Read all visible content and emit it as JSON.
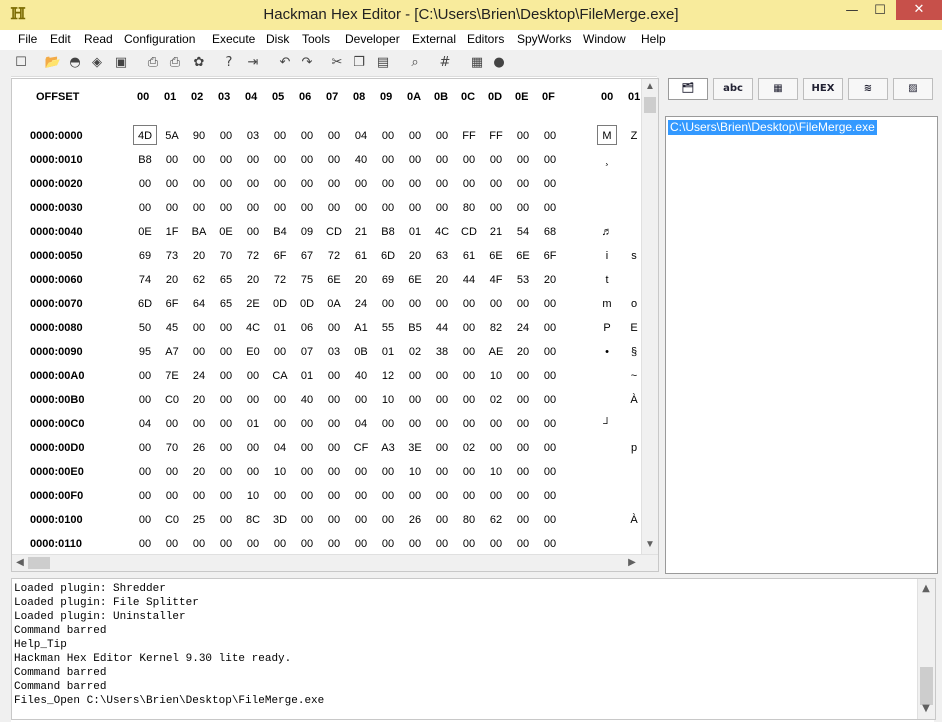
{
  "window": {
    "title": "Hackman Hex Editor - [C:\\Users\\Brien\\Desktop\\FileMerge.exe]",
    "app_icon_glyph": "ℍ",
    "minimize": "—",
    "maximize": "☐",
    "close": "✕",
    "title_bar_color": "#f8eb9c"
  },
  "menu": [
    "File",
    "Edit",
    "Read",
    "Configuration",
    "Execute",
    "Disk",
    "Tools",
    "Developer",
    "External",
    "Editors",
    "SpyWorks",
    "Window",
    "Help"
  ],
  "toolbar_icons": [
    {
      "name": "new-file-icon",
      "glyph": "☐"
    },
    {
      "name": "open-folder-icon",
      "glyph": "📂"
    },
    {
      "name": "open-disk-icon",
      "glyph": "◓"
    },
    {
      "name": "open-drive-icon",
      "glyph": "◈"
    },
    {
      "name": "save-icon",
      "glyph": "▣"
    },
    {
      "name": "print-icon",
      "glyph": "⎙"
    },
    {
      "name": "print-preview-icon",
      "glyph": "⎙"
    },
    {
      "name": "properties-icon",
      "glyph": "✿"
    },
    {
      "name": "help-icon",
      "glyph": "?"
    },
    {
      "name": "exit-icon",
      "glyph": "⇥"
    },
    {
      "name": "undo-icon",
      "glyph": "↶"
    },
    {
      "name": "redo-icon",
      "glyph": "↷"
    },
    {
      "name": "cut-icon",
      "glyph": "✂"
    },
    {
      "name": "copy-icon",
      "glyph": "❐"
    },
    {
      "name": "paste-icon",
      "glyph": "▤"
    },
    {
      "name": "find-icon",
      "glyph": "⌕"
    },
    {
      "name": "goto-icon",
      "glyph": "#"
    },
    {
      "name": "calculator-icon",
      "glyph": "▦"
    },
    {
      "name": "internet-icon",
      "glyph": "●"
    }
  ],
  "hex": {
    "offset_header": "OFFSET",
    "columns": [
      "00",
      "01",
      "02",
      "03",
      "04",
      "05",
      "06",
      "07",
      "08",
      "09",
      "0A",
      "0B",
      "0C",
      "0D",
      "0E",
      "0F"
    ],
    "char_columns": [
      "00",
      "01"
    ],
    "rows": [
      {
        "offset": "0000:0000",
        "bytes": [
          "4D",
          "5A",
          "90",
          "00",
          "03",
          "00",
          "00",
          "00",
          "04",
          "00",
          "00",
          "00",
          "FF",
          "FF",
          "00",
          "00"
        ],
        "chars": [
          "M",
          "Z"
        ]
      },
      {
        "offset": "0000:0010",
        "bytes": [
          "B8",
          "00",
          "00",
          "00",
          "00",
          "00",
          "00",
          "00",
          "40",
          "00",
          "00",
          "00",
          "00",
          "00",
          "00",
          "00"
        ],
        "chars": [
          "¸",
          ""
        ]
      },
      {
        "offset": "0000:0020",
        "bytes": [
          "00",
          "00",
          "00",
          "00",
          "00",
          "00",
          "00",
          "00",
          "00",
          "00",
          "00",
          "00",
          "00",
          "00",
          "00",
          "00"
        ],
        "chars": [
          "",
          ""
        ]
      },
      {
        "offset": "0000:0030",
        "bytes": [
          "00",
          "00",
          "00",
          "00",
          "00",
          "00",
          "00",
          "00",
          "00",
          "00",
          "00",
          "00",
          "80",
          "00",
          "00",
          "00"
        ],
        "chars": [
          "",
          ""
        ]
      },
      {
        "offset": "0000:0040",
        "bytes": [
          "0E",
          "1F",
          "BA",
          "0E",
          "00",
          "B4",
          "09",
          "CD",
          "21",
          "B8",
          "01",
          "4C",
          "CD",
          "21",
          "54",
          "68"
        ],
        "chars": [
          "♬",
          ""
        ]
      },
      {
        "offset": "0000:0050",
        "bytes": [
          "69",
          "73",
          "20",
          "70",
          "72",
          "6F",
          "67",
          "72",
          "61",
          "6D",
          "20",
          "63",
          "61",
          "6E",
          "6E",
          "6F"
        ],
        "chars": [
          "i",
          "s"
        ]
      },
      {
        "offset": "0000:0060",
        "bytes": [
          "74",
          "20",
          "62",
          "65",
          "20",
          "72",
          "75",
          "6E",
          "20",
          "69",
          "6E",
          "20",
          "44",
          "4F",
          "53",
          "20"
        ],
        "chars": [
          "t",
          ""
        ]
      },
      {
        "offset": "0000:0070",
        "bytes": [
          "6D",
          "6F",
          "64",
          "65",
          "2E",
          "0D",
          "0D",
          "0A",
          "24",
          "00",
          "00",
          "00",
          "00",
          "00",
          "00",
          "00"
        ],
        "chars": [
          "m",
          "o"
        ]
      },
      {
        "offset": "0000:0080",
        "bytes": [
          "50",
          "45",
          "00",
          "00",
          "4C",
          "01",
          "06",
          "00",
          "A1",
          "55",
          "B5",
          "44",
          "00",
          "82",
          "24",
          "00"
        ],
        "chars": [
          "P",
          "E"
        ]
      },
      {
        "offset": "0000:0090",
        "bytes": [
          "95",
          "A7",
          "00",
          "00",
          "E0",
          "00",
          "07",
          "03",
          "0B",
          "01",
          "02",
          "38",
          "00",
          "AE",
          "20",
          "00"
        ],
        "chars": [
          "•",
          "§"
        ]
      },
      {
        "offset": "0000:00A0",
        "bytes": [
          "00",
          "7E",
          "24",
          "00",
          "00",
          "CA",
          "01",
          "00",
          "40",
          "12",
          "00",
          "00",
          "00",
          "10",
          "00",
          "00"
        ],
        "chars": [
          "",
          "~"
        ]
      },
      {
        "offset": "0000:00B0",
        "bytes": [
          "00",
          "C0",
          "20",
          "00",
          "00",
          "00",
          "40",
          "00",
          "00",
          "10",
          "00",
          "00",
          "00",
          "02",
          "00",
          "00"
        ],
        "chars": [
          "",
          "À"
        ]
      },
      {
        "offset": "0000:00C0",
        "bytes": [
          "04",
          "00",
          "00",
          "00",
          "01",
          "00",
          "00",
          "00",
          "04",
          "00",
          "00",
          "00",
          "00",
          "00",
          "00",
          "00"
        ],
        "chars": [
          "┘",
          ""
        ]
      },
      {
        "offset": "0000:00D0",
        "bytes": [
          "00",
          "70",
          "26",
          "00",
          "00",
          "04",
          "00",
          "00",
          "CF",
          "A3",
          "3E",
          "00",
          "02",
          "00",
          "00",
          "00"
        ],
        "chars": [
          "",
          "p"
        ]
      },
      {
        "offset": "0000:00E0",
        "bytes": [
          "00",
          "00",
          "20",
          "00",
          "00",
          "10",
          "00",
          "00",
          "00",
          "00",
          "10",
          "00",
          "00",
          "10",
          "00",
          "00"
        ],
        "chars": [
          "",
          ""
        ]
      },
      {
        "offset": "0000:00F0",
        "bytes": [
          "00",
          "00",
          "00",
          "00",
          "10",
          "00",
          "00",
          "00",
          "00",
          "00",
          "00",
          "00",
          "00",
          "00",
          "00",
          "00"
        ],
        "chars": [
          "",
          ""
        ]
      },
      {
        "offset": "0000:0100",
        "bytes": [
          "00",
          "C0",
          "25",
          "00",
          "8C",
          "3D",
          "00",
          "00",
          "00",
          "00",
          "26",
          "00",
          "80",
          "62",
          "00",
          "00"
        ],
        "chars": [
          "",
          "À"
        ]
      },
      {
        "offset": "0000:0110",
        "bytes": [
          "00",
          "00",
          "00",
          "00",
          "00",
          "00",
          "00",
          "00",
          "00",
          "00",
          "00",
          "00",
          "00",
          "00",
          "00",
          "00"
        ],
        "chars": [
          "",
          ""
        ]
      }
    ]
  },
  "side_tabs": [
    {
      "name": "open-files-tab",
      "label": "🗂"
    },
    {
      "name": "strings-tab",
      "label": "abc"
    },
    {
      "name": "table-tab",
      "label": "▦"
    },
    {
      "name": "hex-tab",
      "label": "HEX"
    },
    {
      "name": "layers-tab",
      "label": "≋"
    },
    {
      "name": "plugins-tab",
      "label": "▨"
    }
  ],
  "side_list": {
    "selected_item": "C:\\Users\\Brien\\Desktop\\FileMerge.exe"
  },
  "log": [
    "Loaded plugin: Shredder",
    "Loaded plugin: File Splitter",
    "Loaded plugin: Uninstaller",
    "Command barred",
    "Help_Tip",
    "Hackman Hex Editor Kernel 9.30 lite ready.",
    "Command barred",
    "Command barred",
    "Files_Open C:\\Users\\Brien\\Desktop\\FileMerge.exe"
  ],
  "scroll": {
    "up": "▲",
    "down": "▼",
    "left": "◀",
    "right": "▶"
  }
}
